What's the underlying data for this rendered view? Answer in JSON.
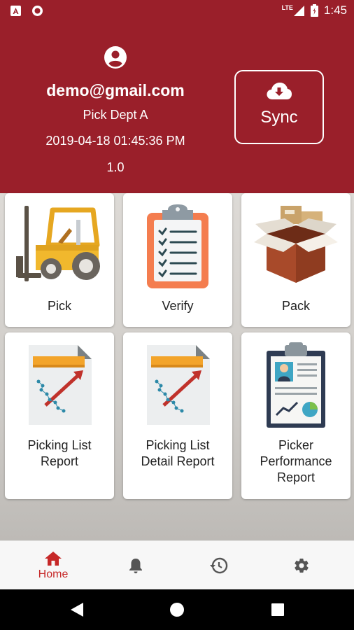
{
  "status_bar": {
    "network": "LTE",
    "time": "1:45",
    "icons": [
      "notification-a-icon",
      "record-icon",
      "signal-icon",
      "battery-icon"
    ]
  },
  "header": {
    "email": "demo@gmail.com",
    "department": "Pick Dept A",
    "datetime": "2019-04-18 01:45:36 PM",
    "version": "1.0",
    "sync_label": "Sync"
  },
  "tiles": [
    {
      "label": "Pick",
      "icon": "forklift-icon"
    },
    {
      "label": "Verify",
      "icon": "clipboard-checklist-icon"
    },
    {
      "label": "Pack",
      "icon": "package-box-icon"
    },
    {
      "label_lines": [
        "Picking List",
        "Report"
      ],
      "icon": "report-chart-icon"
    },
    {
      "label_lines": [
        "Picking List",
        "Detail Report"
      ],
      "icon": "report-chart-icon"
    },
    {
      "label_lines": [
        "Picker",
        "Performance",
        "Report"
      ],
      "icon": "performance-clipboard-icon"
    }
  ],
  "bottom_nav": {
    "home_label": "Home",
    "items": [
      "home-icon",
      "bell-icon",
      "history-icon",
      "settings-icon"
    ]
  },
  "colors": {
    "brand": "#9a1f2a",
    "active_nav": "#c62828"
  }
}
